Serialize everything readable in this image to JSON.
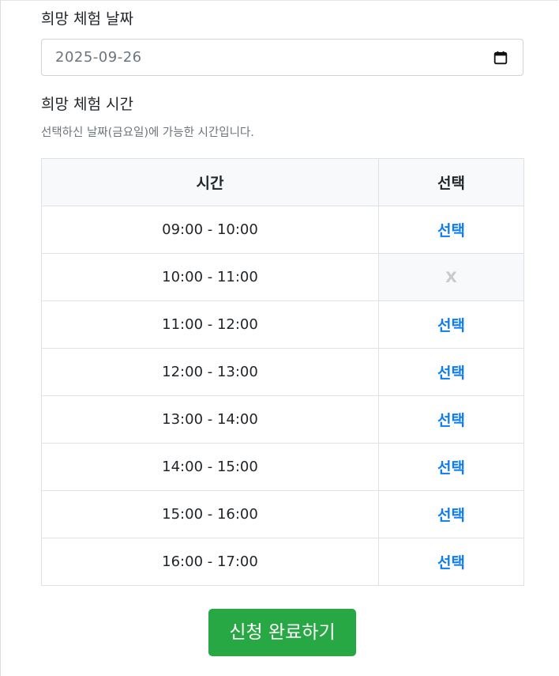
{
  "form": {
    "date_label": "희망 체험 날짜",
    "date_value": "2025-09-26",
    "calendar_icon": "calendar-icon",
    "time_label": "희망 체험 시간",
    "time_hint": "선택하신 날짜(금요일)에 가능한 시간입니다."
  },
  "table": {
    "headers": {
      "time": "시간",
      "select": "선택"
    },
    "rows": [
      {
        "time": "09:00 - 10:00",
        "action": "선택",
        "available": true
      },
      {
        "time": "10:00 - 11:00",
        "action": "X",
        "available": false
      },
      {
        "time": "11:00 - 12:00",
        "action": "선택",
        "available": true
      },
      {
        "time": "12:00 - 13:00",
        "action": "선택",
        "available": true
      },
      {
        "time": "13:00 - 14:00",
        "action": "선택",
        "available": true
      },
      {
        "time": "14:00 - 15:00",
        "action": "선택",
        "available": true
      },
      {
        "time": "15:00 - 16:00",
        "action": "선택",
        "available": true
      },
      {
        "time": "16:00 - 17:00",
        "action": "선택",
        "available": true
      }
    ]
  },
  "submit": {
    "label": "신청 완료하기"
  },
  "colors": {
    "accent_link": "#0d7cf2",
    "submit_bg": "#28a745",
    "unavailable_text": "#c8cbce",
    "header_bg": "#f8f9fa"
  }
}
